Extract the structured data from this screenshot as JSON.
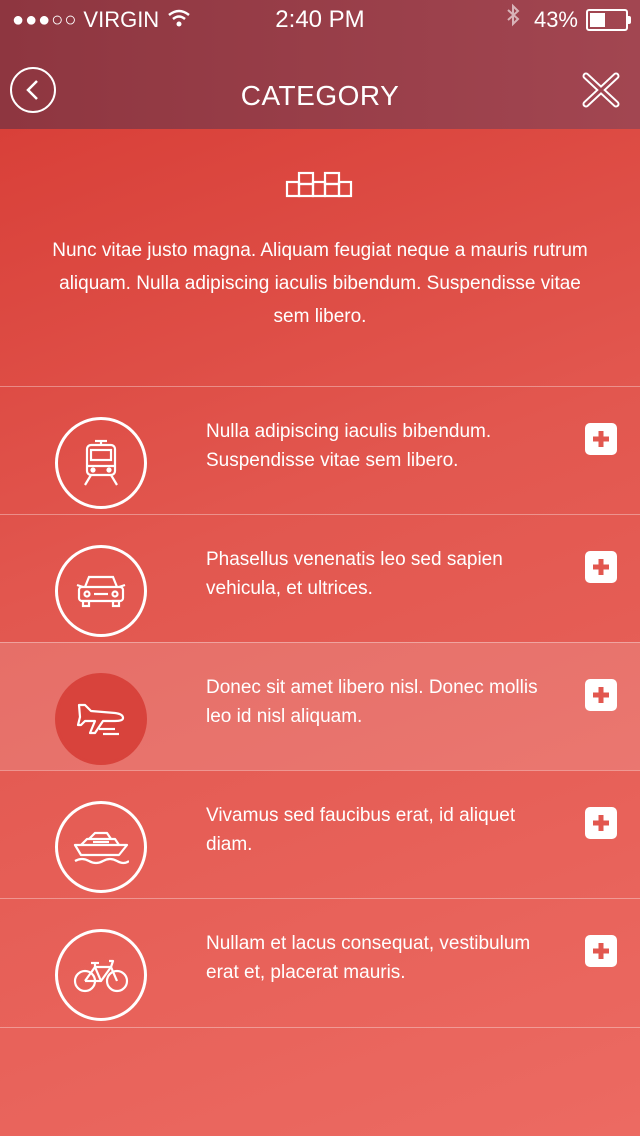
{
  "status_bar": {
    "signal_dots": "●●●○○",
    "carrier": "VIRGIN",
    "time": "2:40 PM",
    "battery_percent_label": "43%",
    "battery_level": 0.43
  },
  "header": {
    "title": "CATEGORY"
  },
  "intro": {
    "icon": "taxi-roof-sign-icon",
    "text": "Nunc vitae justo magna. Aliquam feugiat neque a mauris rutrum aliquam. Nulla adipiscing iaculis bibendum. Suspendisse vitae sem libero."
  },
  "categories": [
    {
      "icon": "train-icon",
      "text": "Nulla adipiscing iaculis bibendum. Suspendisse vitae sem libero.",
      "active": false
    },
    {
      "icon": "car-icon",
      "text": "Phasellus venenatis leo sed sapien vehicula, et ultrices.",
      "active": false
    },
    {
      "icon": "airplane-icon",
      "text": "Donec sit amet libero nisl. Donec mollis leo id nisl aliquam.",
      "active": true
    },
    {
      "icon": "boat-icon",
      "text": "Vivamus sed faucibus erat, id aliquet diam.",
      "active": false
    },
    {
      "icon": "bicycle-icon",
      "text": "Nullam et lacus consequat, vestibulum erat et, placerat mauris.",
      "active": false
    }
  ],
  "colors": {
    "accent": "#e2574f",
    "header": "#993e48",
    "active_circle": "#d8433c"
  }
}
